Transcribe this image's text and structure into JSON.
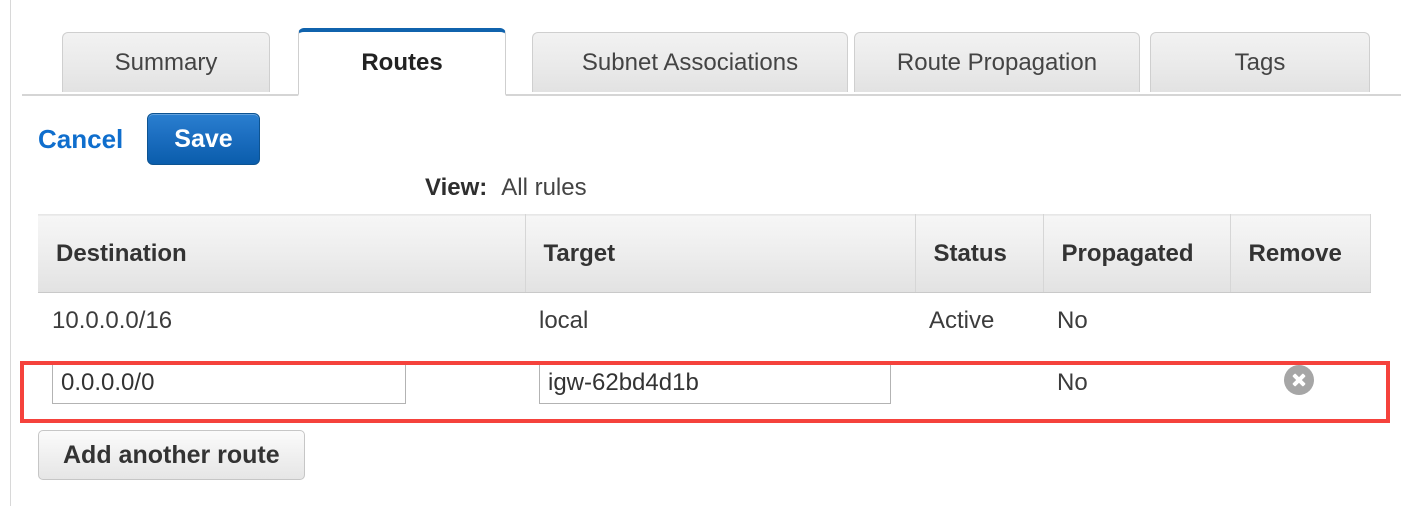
{
  "tabs": [
    {
      "label": "Summary",
      "active": false
    },
    {
      "label": "Routes",
      "active": true
    },
    {
      "label": "Subnet Associations",
      "active": false
    },
    {
      "label": "Route Propagation",
      "active": false
    },
    {
      "label": "Tags",
      "active": false
    }
  ],
  "actions": {
    "cancel_label": "Cancel",
    "save_label": "Save"
  },
  "view": {
    "label": "View:",
    "value": "All rules"
  },
  "table": {
    "columns": [
      "Destination",
      "Target",
      "Status",
      "Propagated",
      "Remove"
    ],
    "rows": [
      {
        "type": "static",
        "destination": "10.0.0.0/16",
        "target": "local",
        "status": "Active",
        "propagated": "No",
        "remove": ""
      },
      {
        "type": "editable",
        "destination": "0.0.0.0/0",
        "destination_placeholder": "",
        "target": "igw-62bd4d1b",
        "target_placeholder": "",
        "status": "",
        "propagated": "No",
        "remove": "remove-icon"
      }
    ]
  },
  "footer": {
    "add_route_label": "Add another route"
  },
  "colors": {
    "accent_blue": "#1063ad",
    "link_blue": "#0f6ecd",
    "status_active_green": "#15922e",
    "highlight_red": "#f5423c",
    "remove_icon_gray": "#a6a6a6"
  }
}
